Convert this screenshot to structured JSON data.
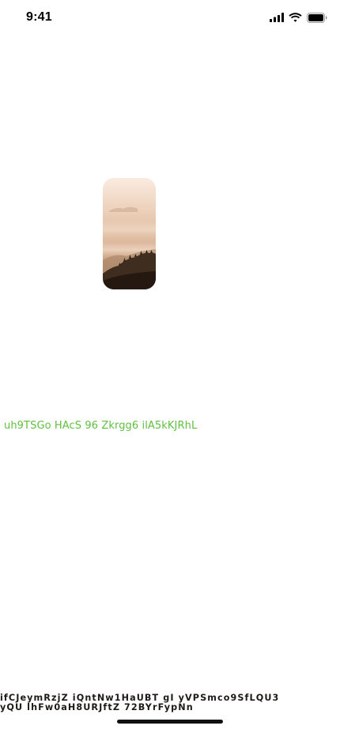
{
  "status_bar": {
    "time": "9:41",
    "icons": [
      "cellular-signal-icon",
      "wifi-icon",
      "battery-icon"
    ]
  },
  "image": {
    "description_icon": "misty-mountain-photo"
  },
  "text": {
    "green_line": "uh9TSGo HAcS 96 Zkrgg6 ilA5kKJRhL",
    "bottom_line_1": "ifCJeymRzjZ iQntNw1HaUBT gI yVPSmco9SfLQU3",
    "bottom_line_2": "yQU lhFw0aH8URJftZ 72BYrFypNn"
  },
  "colors": {
    "green_text": "#5fbf3f",
    "bottom_text": "#1e1a16",
    "home_indicator": "#111111"
  }
}
